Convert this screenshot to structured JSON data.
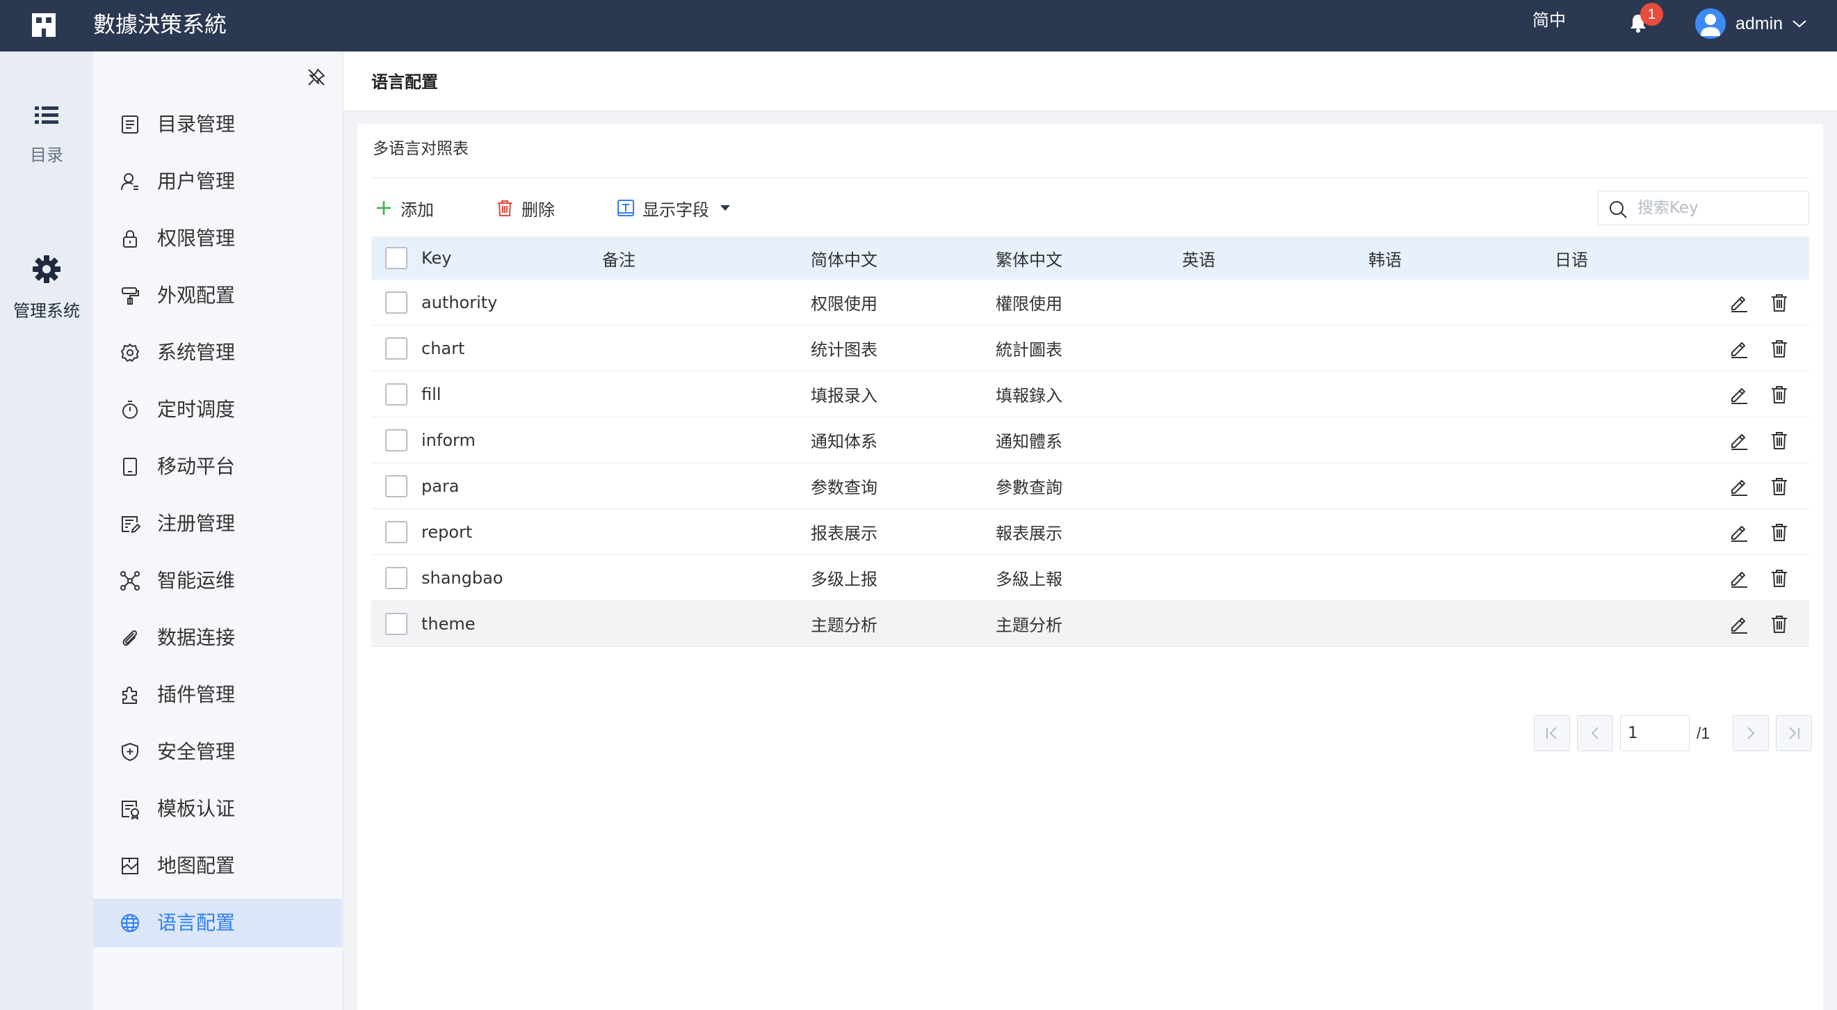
{
  "app": {
    "title": "數據決策系統"
  },
  "topbar": {
    "language": "简中",
    "notifications": "1",
    "username": "admin"
  },
  "rail": [
    {
      "label": "目录",
      "icon": "list-icon"
    },
    {
      "label": "管理系统",
      "icon": "gear-icon"
    }
  ],
  "sidebar": {
    "items": [
      {
        "label": "目录管理",
        "icon": "catalog-icon"
      },
      {
        "label": "用户管理",
        "icon": "user-icon"
      },
      {
        "label": "权限管理",
        "icon": "lock-icon"
      },
      {
        "label": "外观配置",
        "icon": "paint-roller-icon"
      },
      {
        "label": "系统管理",
        "icon": "cog-icon"
      },
      {
        "label": "定时调度",
        "icon": "stopwatch-icon"
      },
      {
        "label": "移动平台",
        "icon": "tablet-icon"
      },
      {
        "label": "注册管理",
        "icon": "register-icon"
      },
      {
        "label": "智能运维",
        "icon": "network-icon"
      },
      {
        "label": "数据连接",
        "icon": "paperclip-icon"
      },
      {
        "label": "插件管理",
        "icon": "puzzle-icon"
      },
      {
        "label": "安全管理",
        "icon": "shield-icon"
      },
      {
        "label": "模板认证",
        "icon": "template-cert-icon"
      },
      {
        "label": "地图配置",
        "icon": "map-icon"
      },
      {
        "label": "语言配置",
        "icon": "globe-icon",
        "active": true
      }
    ]
  },
  "page": {
    "title": "语言配置"
  },
  "panel": {
    "title": "多语言对照表",
    "toolbar": {
      "add": "添加",
      "delete": "删除",
      "fields": "显示字段"
    },
    "search": {
      "placeholder": "搜索Key",
      "value": ""
    }
  },
  "table": {
    "headers": [
      "Key",
      "备注",
      "简体中文",
      "繁体中文",
      "英语",
      "韩语",
      "日语"
    ],
    "rows": [
      {
        "key": "authority",
        "note": "",
        "zh_cn": "权限使用",
        "zh_tw": "權限使用",
        "en": "",
        "ko": "",
        "ja": ""
      },
      {
        "key": "chart",
        "note": "",
        "zh_cn": "统计图表",
        "zh_tw": "統計圖表",
        "en": "",
        "ko": "",
        "ja": ""
      },
      {
        "key": "fill",
        "note": "",
        "zh_cn": "填报录入",
        "zh_tw": "填報錄入",
        "en": "",
        "ko": "",
        "ja": ""
      },
      {
        "key": "inform",
        "note": "",
        "zh_cn": "通知体系",
        "zh_tw": "通知體系",
        "en": "",
        "ko": "",
        "ja": ""
      },
      {
        "key": "para",
        "note": "",
        "zh_cn": "参数查询",
        "zh_tw": "參數查詢",
        "en": "",
        "ko": "",
        "ja": ""
      },
      {
        "key": "report",
        "note": "",
        "zh_cn": "报表展示",
        "zh_tw": "報表展示",
        "en": "",
        "ko": "",
        "ja": ""
      },
      {
        "key": "shangbao",
        "note": "",
        "zh_cn": "多级上报",
        "zh_tw": "多級上報",
        "en": "",
        "ko": "",
        "ja": ""
      },
      {
        "key": "theme",
        "note": "",
        "zh_cn": "主题分析",
        "zh_tw": "主題分析",
        "en": "",
        "ko": "",
        "ja": ""
      }
    ]
  },
  "pagination": {
    "current": "1",
    "total": "/1"
  },
  "colors": {
    "topbar": "#2b3852",
    "accent": "#2f7df6",
    "add": "#2fb34a",
    "delete": "#e0473b"
  }
}
